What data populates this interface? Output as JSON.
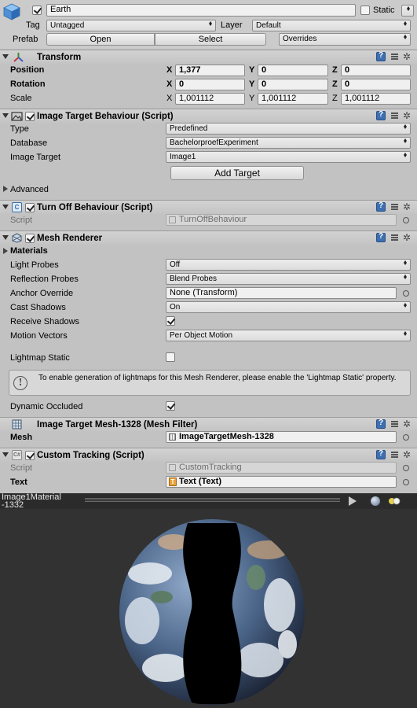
{
  "object": {
    "name": "Earth",
    "static_label": "Static",
    "static_checked": false,
    "active": true
  },
  "tag": {
    "label": "Tag",
    "value": "Untagged"
  },
  "layer": {
    "label": "Layer",
    "value": "Default"
  },
  "prefab": {
    "label": "Prefab",
    "open": "Open",
    "select": "Select",
    "overrides": "Overrides"
  },
  "transform": {
    "title": "Transform",
    "position": {
      "label": "Position",
      "x": "1,377",
      "y": "0",
      "z": "0"
    },
    "rotation": {
      "label": "Rotation",
      "x": "0",
      "y": "0",
      "z": "0"
    },
    "scale": {
      "label": "Scale",
      "x": "1,001112",
      "y": "1,001112",
      "z": "1,001112"
    },
    "axis_x": "X",
    "axis_y": "Y",
    "axis_z": "Z"
  },
  "image_target": {
    "title": "Image Target Behaviour (Script)",
    "type_label": "Type",
    "type_value": "Predefined",
    "database_label": "Database",
    "database_value": "BachelorproefExperiment",
    "target_label": "Image Target",
    "target_value": "Image1",
    "add_target": "Add Target",
    "advanced": "Advanced"
  },
  "turn_off": {
    "title": "Turn Off Behaviour (Script)",
    "script_label": "Script",
    "script_value": "TurnOffBehaviour"
  },
  "mesh_renderer": {
    "title": "Mesh Renderer",
    "materials": "Materials",
    "light_probes_label": "Light Probes",
    "light_probes_value": "Off",
    "reflection_label": "Reflection Probes",
    "reflection_value": "Blend Probes",
    "anchor_label": "Anchor Override",
    "anchor_value": "None (Transform)",
    "cast_label": "Cast Shadows",
    "cast_value": "On",
    "receive_label": "Receive Shadows",
    "motion_label": "Motion Vectors",
    "motion_value": "Per Object Motion",
    "lightmap_label": "Lightmap Static",
    "info": "To enable generation of lightmaps for this Mesh Renderer, please enable the 'Lightmap Static' property.",
    "occluded_label": "Dynamic Occluded"
  },
  "mesh_filter": {
    "title": "Image Target Mesh-1328 (Mesh Filter)",
    "mesh_label": "Mesh",
    "mesh_value": "ImageTargetMesh-1328"
  },
  "custom_tracking": {
    "title": "Custom Tracking (Script)",
    "script_label": "Script",
    "script_value": "CustomTracking",
    "text_label": "Text",
    "text_value": "Text (Text)"
  },
  "preview": {
    "material_line1": "Image1Material",
    "material_line2": "-1332"
  },
  "colors": {
    "panel": "#c2c2c2",
    "preview_bg": "#323232",
    "dark_bar": "#2b2b2b"
  }
}
